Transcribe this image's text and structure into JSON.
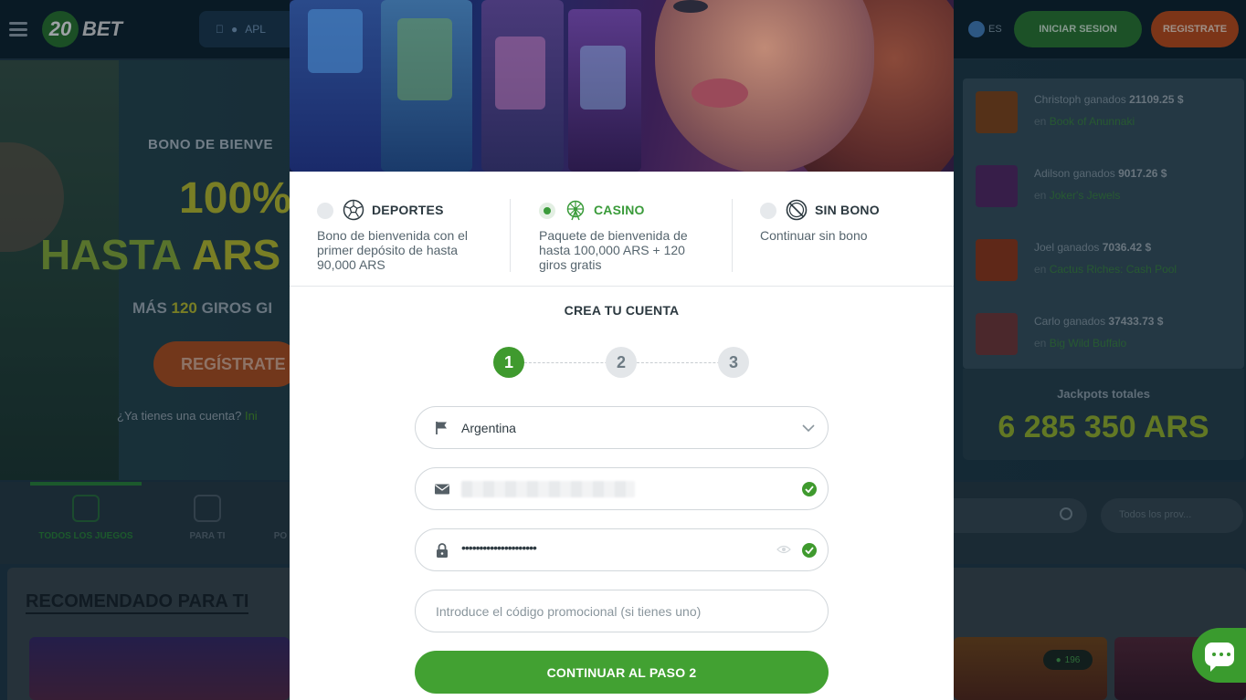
{
  "background_site": {
    "logo_badge": "20",
    "logo_text": "BET",
    "apps_label": "APL",
    "lang": "ES",
    "login_button": "INICIAR SESION",
    "register_button": "REGISTRATE",
    "hero": {
      "line1": "BONO DE BIENVE",
      "line2": "100%",
      "line3_prefix": "HASTA ",
      "line3_highlight": "ARS",
      "line4_prefix": "MÁS ",
      "line4_highlight": "120",
      "line4_suffix": " GIROS GI",
      "cta": "REGÍSTRATE",
      "account_prompt": "¿Ya tienes una cuenta? ",
      "account_link": "Ini"
    },
    "winners": [
      {
        "name": "Christoph",
        "verb": "ganados",
        "amount": "21109.25 $",
        "prep": "en",
        "game": "Book of Anunnaki",
        "color": "#8a4a1a"
      },
      {
        "name": "Adilson",
        "verb": "ganados",
        "amount": "9017.26 $",
        "prep": "en",
        "game": "Joker's Jewels",
        "color": "#5a2a6a"
      },
      {
        "name": "Joel",
        "verb": "ganados",
        "amount": "7036.42 $",
        "prep": "en",
        "game": "Cactus Riches: Cash Pool",
        "color": "#9a3a1a"
      },
      {
        "name": "Carlo",
        "verb": "ganados",
        "amount": "37433.73 $",
        "prep": "en",
        "game": "Big Wild Buffalo",
        "color": "#7a3a3a"
      }
    ],
    "jackpot_label": "Jackpots totales",
    "jackpot_value": "6 285 350 ARS",
    "categories": [
      "TODOS LOS JUEGOS",
      "PARA TI",
      "PO"
    ],
    "providers_placeholder": "Todos los prov...",
    "recommended_title": "RECOMENDADO PARA TI",
    "game_badge": "196"
  },
  "modal": {
    "bonuses": [
      {
        "title": "DEPORTES",
        "desc": "Bono de bienvenida con el primer depósito de hasta 90,000 ARS",
        "selected": false,
        "icon": "soccer-ball-icon"
      },
      {
        "title": "CASINO",
        "desc": "Paquete de bienvenida de hasta 100,000 ARS + 120 giros gratis",
        "selected": true,
        "icon": "ferris-wheel-icon"
      },
      {
        "title": "SIN BONO",
        "desc": "Continuar sin bono",
        "selected": false,
        "icon": "no-bonus-icon"
      }
    ],
    "create_title": "CREA TU CUENTA",
    "steps": [
      "1",
      "2",
      "3"
    ],
    "active_step": 1,
    "country_value": "Argentina",
    "password_mask": "•••••••••••••••••••••",
    "promo_placeholder": "Introduce el código promocional (si tienes uno)",
    "cta_label": "CONTINUAR AL PASO 2"
  },
  "colors": {
    "primary_green": "#42a132",
    "text_dark": "#2c3940",
    "muted": "#56656e"
  }
}
